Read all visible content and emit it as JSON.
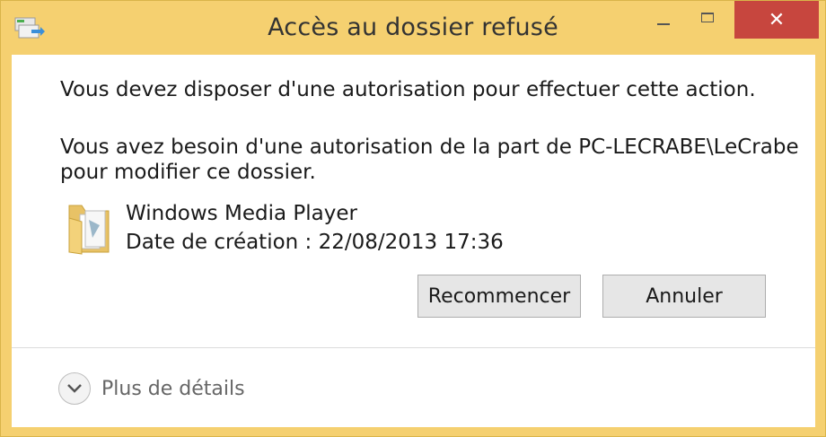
{
  "window": {
    "title": "Accès au dossier refusé",
    "close_glyph": "✕"
  },
  "message": {
    "line1": "Vous devez disposer d'une autorisation pour effectuer cette action.",
    "line2": "Vous avez besoin d'une autorisation de la part de PC-LECRABE\\LeCrabe",
    "line3": "pour modifier ce dossier."
  },
  "item": {
    "name": "Windows Media Player",
    "created": "Date de création : 22/08/2013 17:36",
    "icon": "folder-icon"
  },
  "buttons": {
    "retry": "Recommencer",
    "cancel": "Annuler"
  },
  "footer": {
    "details_label": "Plus de détails"
  },
  "colors": {
    "frame": "#f5d070",
    "close": "#c7463e",
    "client": "#ffffff"
  }
}
